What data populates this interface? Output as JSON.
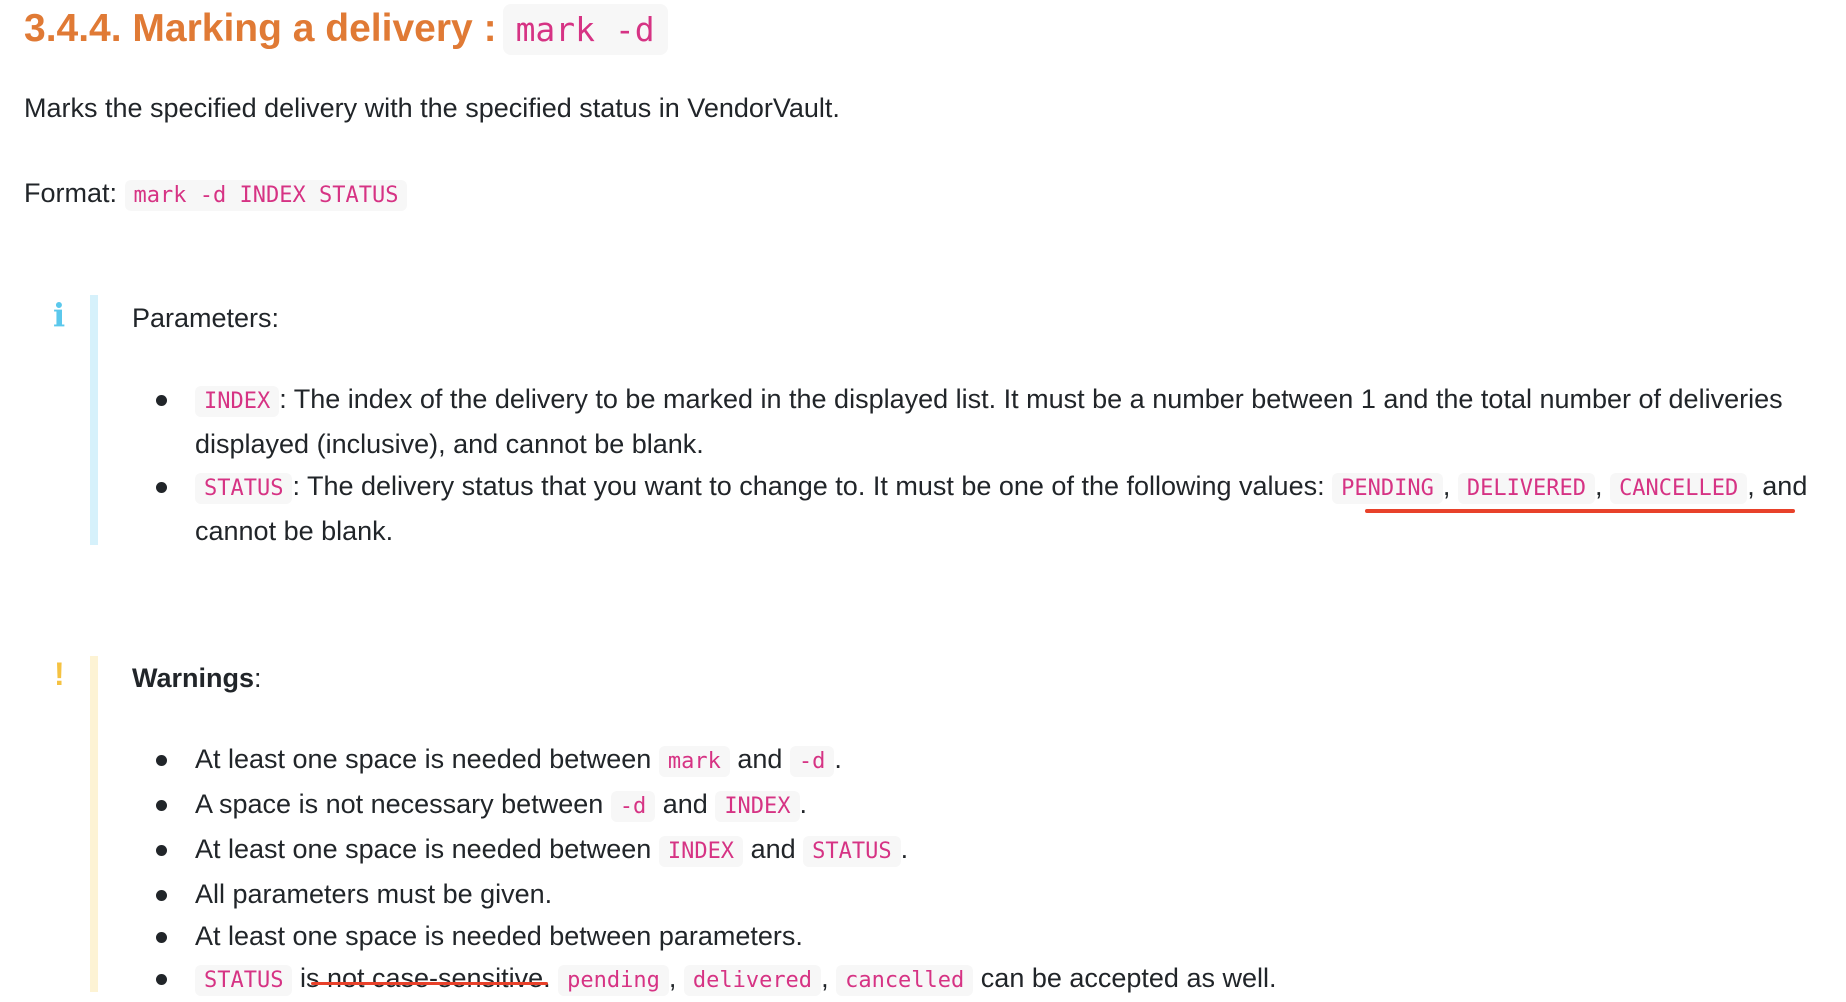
{
  "heading": {
    "title": "3.4.4. Marking a delivery :",
    "code": "mark -d"
  },
  "description": "Marks the specified delivery with the specified status in VendorVault.",
  "format": {
    "label": "Format:",
    "code": "mark -d INDEX STATUS"
  },
  "info_callout": {
    "icon": "i",
    "title": "Parameters:",
    "items": [
      {
        "code": "INDEX",
        "text": ": The index of the delivery to be marked in the displayed list. It must be a number between 1 and the total number of deliveries displayed (inclusive), and cannot be blank."
      },
      {
        "code": "STATUS",
        "text_before": ": The delivery status that you want to change to. It must be one of the following values: ",
        "values": [
          "PENDING",
          "DELIVERED",
          "CANCELLED"
        ],
        "text_after": ", and cannot be blank."
      }
    ]
  },
  "warning_callout": {
    "icon": "!",
    "title": "Warnings",
    "title_suffix": ":",
    "items": [
      {
        "parts": [
          "At least one space is needed between ",
          {
            "code": "mark"
          },
          " and ",
          {
            "code": "-d"
          },
          "."
        ]
      },
      {
        "parts": [
          "A space is not necessary between ",
          {
            "code": "-d"
          },
          " and ",
          {
            "code": "INDEX"
          },
          "."
        ]
      },
      {
        "parts": [
          "At least one space is needed between ",
          {
            "code": "INDEX"
          },
          " and ",
          {
            "code": "STATUS"
          },
          "."
        ]
      },
      {
        "parts": [
          "All parameters must be given."
        ]
      },
      {
        "parts": [
          "At least one space is needed between parameters."
        ]
      },
      {
        "parts": [
          {
            "code": "STATUS"
          },
          " is not case-sensitive. ",
          {
            "code": "pending"
          },
          ", ",
          {
            "code": "delivered"
          },
          ", ",
          {
            "code": "cancelled"
          },
          " can be accepted as well."
        ]
      }
    ]
  },
  "colors": {
    "heading": "#e07a35",
    "code_text": "#d63384",
    "code_bg": "#f7f7f7",
    "info_bar": "#d6f1fb",
    "info_icon": "#5bc8ec",
    "warning_bar": "#fdf3d4",
    "warning_icon": "#f5c242",
    "annotation_red": "#e8412a"
  }
}
